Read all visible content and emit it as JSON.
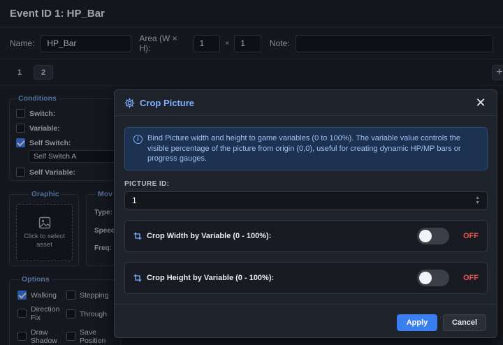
{
  "editor": {
    "title": "Event ID 1: HP_Bar",
    "name_label": "Name:",
    "name_value": "HP_Bar",
    "area_label": "Area (W × H):",
    "area_w": "1",
    "area_x": "×",
    "area_h": "1",
    "note_label": "Note:",
    "note_value": "",
    "tabs": [
      "1",
      "2"
    ],
    "add_tab": "+"
  },
  "conditions": {
    "title": "Conditions",
    "switch": "Switch:",
    "variable": "Variable:",
    "self_switch": "Self Switch:",
    "self_switch_value": "Self Switch A",
    "self_variable": "Self Variable:"
  },
  "graphic": {
    "title": "Graphic",
    "placeholder": "Click to select asset"
  },
  "movement": {
    "title": "Mov",
    "type": "Type:",
    "speed": "Speed",
    "freq": "Freq:"
  },
  "options": {
    "title": "Options",
    "walking": "Walking",
    "stepping": "Stepping",
    "direction_fix": "Direction Fix",
    "through": "Through",
    "draw_shadow": "Draw Shadow",
    "save_position": "Save Position"
  },
  "modal": {
    "title": "Crop Picture",
    "info": "Bind Picture width and height to game variables (0 to 100%). The variable value controls the visible percentage of the picture from origin (0,0), useful for creating dynamic HP/MP bars or progress gauges.",
    "picture_id_label": "PICTURE ID:",
    "picture_id_value": "1",
    "crop_width_label": "Crop Width by Variable (0 - 100%):",
    "crop_width_state": "OFF",
    "crop_height_label": "Crop Height by Variable (0 - 100%):",
    "crop_height_state": "OFF",
    "apply": "Apply",
    "cancel": "Cancel"
  },
  "colors": {
    "accent": "#3a7ef0",
    "off": "#ef5350",
    "info_text": "#9dc1f2"
  }
}
